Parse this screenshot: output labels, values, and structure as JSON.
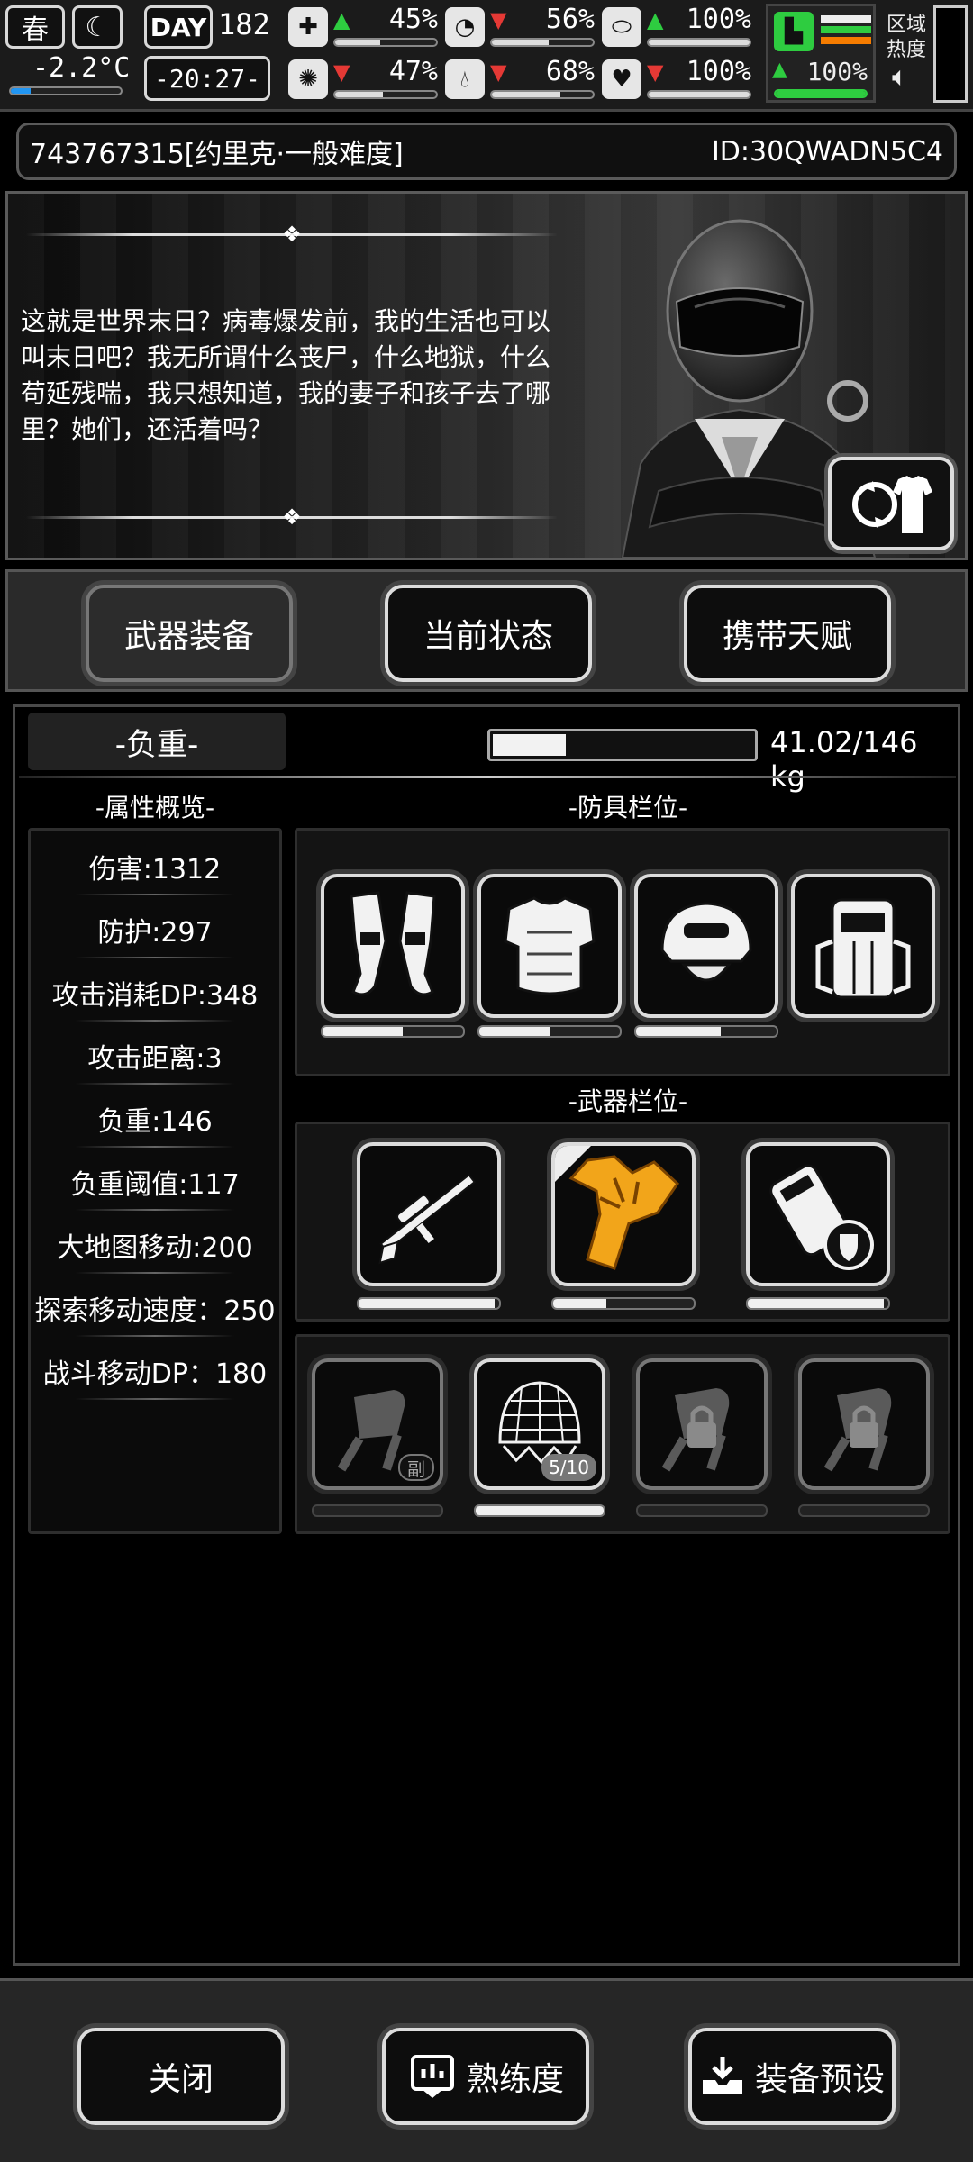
{
  "status": {
    "season": "春",
    "day_label": "DAY",
    "day": "182",
    "temperature": "-2.2°C",
    "time": "-20:27-",
    "region_heat_label": "区域\n热度",
    "stats": [
      {
        "icon": "medkit-icon",
        "trend": "up",
        "value": "45%",
        "fill": 0.45
      },
      {
        "icon": "stomach-icon",
        "trend": "down",
        "value": "56%",
        "fill": 0.56
      },
      {
        "icon": "capsule-icon",
        "trend": "up",
        "value": "100%",
        "fill": 1.0
      },
      {
        "icon": "brain-icon",
        "trend": "down",
        "value": "47%",
        "fill": 0.47
      },
      {
        "icon": "water-drop-icon",
        "trend": "down",
        "value": "68%",
        "fill": 0.68
      },
      {
        "icon": "heart-icon",
        "trend": "down",
        "value": "100%",
        "fill": 1.0
      }
    ],
    "boot": {
      "trend": "up",
      "value": "100%",
      "fill": 1.0
    }
  },
  "header": {
    "title": "743767315[约里克·一般难度]",
    "id": "ID:30QWADN5C4"
  },
  "story": {
    "text": "这就是世界末日？病毒爆发前，我的生活也可以叫末日吧？我无所谓什么丧尸，什么地狱，什么苟延残喘，我只想知道，我的妻子和孩子去了哪里？她们，还活着吗？"
  },
  "tabs": [
    {
      "label": "武器装备",
      "active": true
    },
    {
      "label": "当前状态",
      "active": false
    },
    {
      "label": "携带天赋",
      "active": false
    }
  ],
  "load": {
    "label": "-负重-",
    "value": "41.02/146 kg",
    "fraction": 0.28
  },
  "attributes": {
    "heading": "-属性概览-",
    "items": [
      "伤害:1312",
      "防护:297",
      "攻击消耗DP:348",
      "攻击距离:3",
      "负重:146",
      "负重阈值:117",
      "大地图移动:200",
      "探索移动速度：250",
      "战斗移动DP：180"
    ]
  },
  "armor": {
    "heading": "-防具栏位-",
    "slots": [
      {
        "icon": "leg-guards-icon",
        "durability": 0.57
      },
      {
        "icon": "body-armor-icon",
        "durability": 0.5
      },
      {
        "icon": "helmet-icon",
        "durability": 0.6
      },
      {
        "icon": "backpack-icon",
        "durability": null
      }
    ]
  },
  "weapons": {
    "heading": "-武器栏位-",
    "slots": [
      {
        "icon": "sniper-rifle-icon",
        "durability": 0.97
      },
      {
        "icon": "flame-fist-icon",
        "durability": 0.38
      },
      {
        "icon": "gadget-shield-icon",
        "durability": 0.97
      }
    ]
  },
  "extra_slots": [
    {
      "icon": "offhand-fist-icon",
      "badge": "副",
      "durability": 0.0
    },
    {
      "icon": "net-trap-icon",
      "badge": "5/10",
      "durability": 1.0
    },
    {
      "icon": "locked-fist-icon",
      "badge": "",
      "durability": 0.0
    },
    {
      "icon": "locked-fist-icon",
      "badge": "",
      "durability": 0.0
    }
  ],
  "bottom": {
    "close": "关闭",
    "proficiency": "熟练度",
    "preset": "装备预设"
  }
}
